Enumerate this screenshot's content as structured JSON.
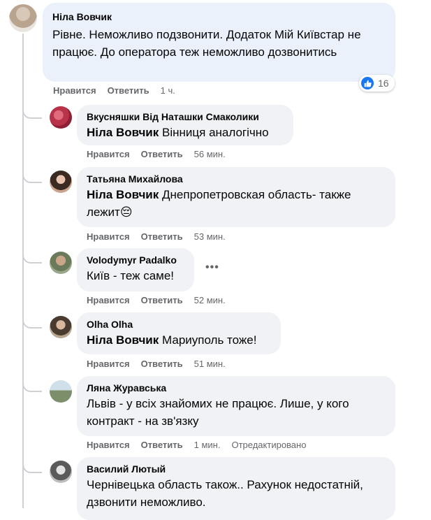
{
  "comments": [
    {
      "author": "Ніла Вовчик",
      "mention": "",
      "text": "Рівне. Неможливо подзвонити. Додаток Мій Київстар не працює. До оператора теж неможливо дозвонитись",
      "like": "Нравится",
      "reply": "Ответить",
      "time": "1 ч.",
      "reactions_count": "16"
    },
    {
      "author": "Вкусняшки Від Наташки Смаколики",
      "mention": "Ніла Вовчик",
      "text": "Вінниця аналогічно",
      "like": "Нравится",
      "reply": "Ответить",
      "time": "56 мин."
    },
    {
      "author": "Татьяна Михайлова",
      "mention": "Ніла Вовчик",
      "text": "Днепропетровская область- также лежит😔",
      "like": "Нравится",
      "reply": "Ответить",
      "time": "53 мин."
    },
    {
      "author": "Volodymyr Padalko",
      "mention": "",
      "text": "Київ - теж саме!",
      "like": "Нравится",
      "reply": "Ответить",
      "time": "52 мин.",
      "more": "•••"
    },
    {
      "author": "Olha Olha",
      "mention": "Ніла Вовчик",
      "text": "Мариуполь тоже!",
      "like": "Нравится",
      "reply": "Ответить",
      "time": "51 мин."
    },
    {
      "author": "Ляна Журавська",
      "mention": "",
      "text": "Львів - у всіх знайомих не працює. Лише, у кого контракт - на зв'язку",
      "like": "Нравится",
      "reply": "Ответить",
      "time": "1 мин.",
      "edited": "Отредактировано"
    },
    {
      "author": "Василий Лютый",
      "mention": "",
      "text": "Чернівецька область також.. Рахунок недостатній, дзвонити неможливо."
    }
  ]
}
